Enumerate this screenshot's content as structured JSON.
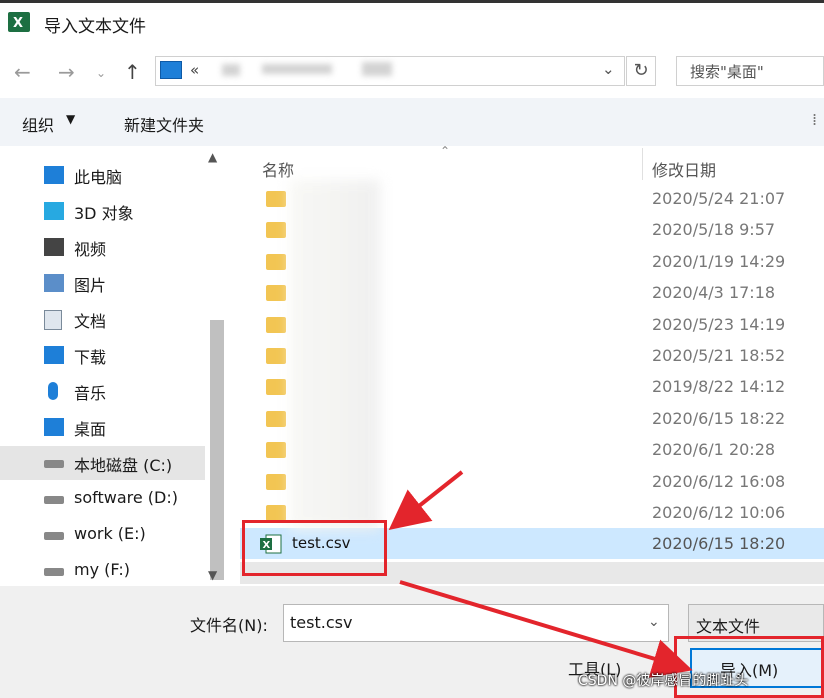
{
  "window": {
    "title": "导入文本文件"
  },
  "address": {
    "text": "«",
    "search_placeholder": "搜索\"桌面\""
  },
  "toolbar": {
    "organize_label": "组织",
    "new_folder_label": "新建文件夹"
  },
  "sidebar": {
    "items": [
      {
        "label": "此电脑",
        "icon": "computer-icon"
      },
      {
        "label": "3D 对象",
        "icon": "cube-icon"
      },
      {
        "label": "视频",
        "icon": "video-icon"
      },
      {
        "label": "图片",
        "icon": "picture-icon"
      },
      {
        "label": "文档",
        "icon": "document-icon"
      },
      {
        "label": "下载",
        "icon": "download-icon"
      },
      {
        "label": "音乐",
        "icon": "music-icon"
      },
      {
        "label": "桌面",
        "icon": "desktop-icon"
      },
      {
        "label": "本地磁盘 (C:)",
        "icon": "drive-icon",
        "selected": true
      },
      {
        "label": "software (D:)",
        "icon": "drive-icon"
      },
      {
        "label": "work (E:)",
        "icon": "drive-icon"
      },
      {
        "label": "my (F:)",
        "icon": "drive-icon"
      }
    ]
  },
  "filelist": {
    "columns": {
      "name": "名称",
      "date": "修改日期"
    },
    "rows": [
      {
        "name": "",
        "date": "2020/5/24 21:07"
      },
      {
        "name": "",
        "date": "2020/5/18 9:57"
      },
      {
        "name": "",
        "date": "2020/1/19 14:29"
      },
      {
        "name": "",
        "date": "2020/4/3 17:18"
      },
      {
        "name": "",
        "date": "2020/5/23 14:19"
      },
      {
        "name": "",
        "date": "2020/5/21 18:52"
      },
      {
        "name": "",
        "date": "2019/8/22 14:12"
      },
      {
        "name": "",
        "date": "2020/6/15 18:22"
      },
      {
        "name": "",
        "date": "2020/6/1 20:28"
      },
      {
        "name": "",
        "date": "2020/6/12 16:08"
      },
      {
        "name": "",
        "date": "2020/6/12 10:06"
      },
      {
        "name": "test.csv",
        "date": "2020/6/15 18:20",
        "selected": true,
        "icon": "excel-file-icon"
      }
    ]
  },
  "bottom": {
    "filename_label": "文件名(N):",
    "filename_value": "test.csv",
    "filetype_value": "文本文件",
    "tools_label": "工具(L)",
    "import_label": "导入(M)"
  },
  "watermark": "CSDN @彼岸感冒的脚趾头",
  "colors": {
    "accent": "#0078d7",
    "selection": "#cde8ff",
    "annotation": "#e3252c",
    "folder": "#f2c553",
    "excel": "#1d6f42"
  }
}
